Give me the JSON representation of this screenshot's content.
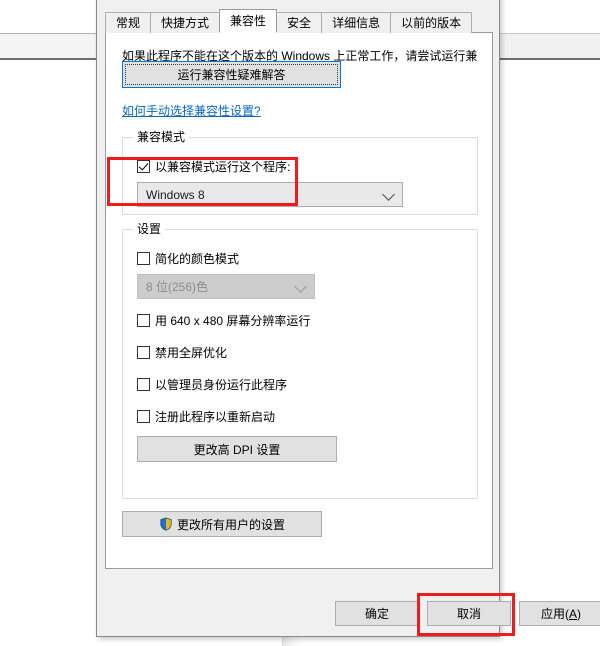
{
  "dialog": {
    "tabs": [
      {
        "label": "常规",
        "selected": false
      },
      {
        "label": "快捷方式",
        "selected": false
      },
      {
        "label": "兼容性",
        "selected": true
      },
      {
        "label": "安全",
        "selected": false
      },
      {
        "label": "详细信息",
        "selected": false
      },
      {
        "label": "以前的版本",
        "selected": false
      }
    ],
    "intro_text": "如果此程序不能在这个版本的 Windows 上正常工作，请尝试运行兼容性疑难解答。",
    "troubleshoot_button": "运行兼容性疑难解答",
    "help_link": "如何手动选择兼容性设置?",
    "compat_group": {
      "title": "兼容模式",
      "checkbox_label": "以兼容模式运行这个程序:",
      "checkbox_checked": true,
      "combo_value": "Windows 8"
    },
    "settings_group": {
      "title": "设置",
      "color_mode_label": "简化的颜色模式",
      "color_mode_checked": false,
      "color_depth_value": "8 位(256)色",
      "color_depth_disabled": true,
      "checkboxes": [
        {
          "label": "用 640 x 480 屏幕分辨率运行",
          "checked": false
        },
        {
          "label": "禁用全屏优化",
          "checked": false
        },
        {
          "label": "以管理员身份运行此程序",
          "checked": false
        },
        {
          "label": "注册此程序以重新启动",
          "checked": false
        }
      ],
      "dpi_button": "更改高 DPI 设置"
    },
    "change_all_users_button": "更改所有用户的设置",
    "footer": {
      "ok": "确定",
      "cancel": "取消",
      "apply_text": "应用(",
      "apply_accel": "A",
      "apply_close": ")"
    }
  },
  "annotations": {
    "color": "#f01c1c",
    "items": [
      {
        "name": "compat-mode-highlight"
      },
      {
        "name": "apply-button-highlight"
      }
    ]
  },
  "icons": {
    "shield": "uac-shield-icon",
    "chevron": "chevron-down-icon"
  }
}
